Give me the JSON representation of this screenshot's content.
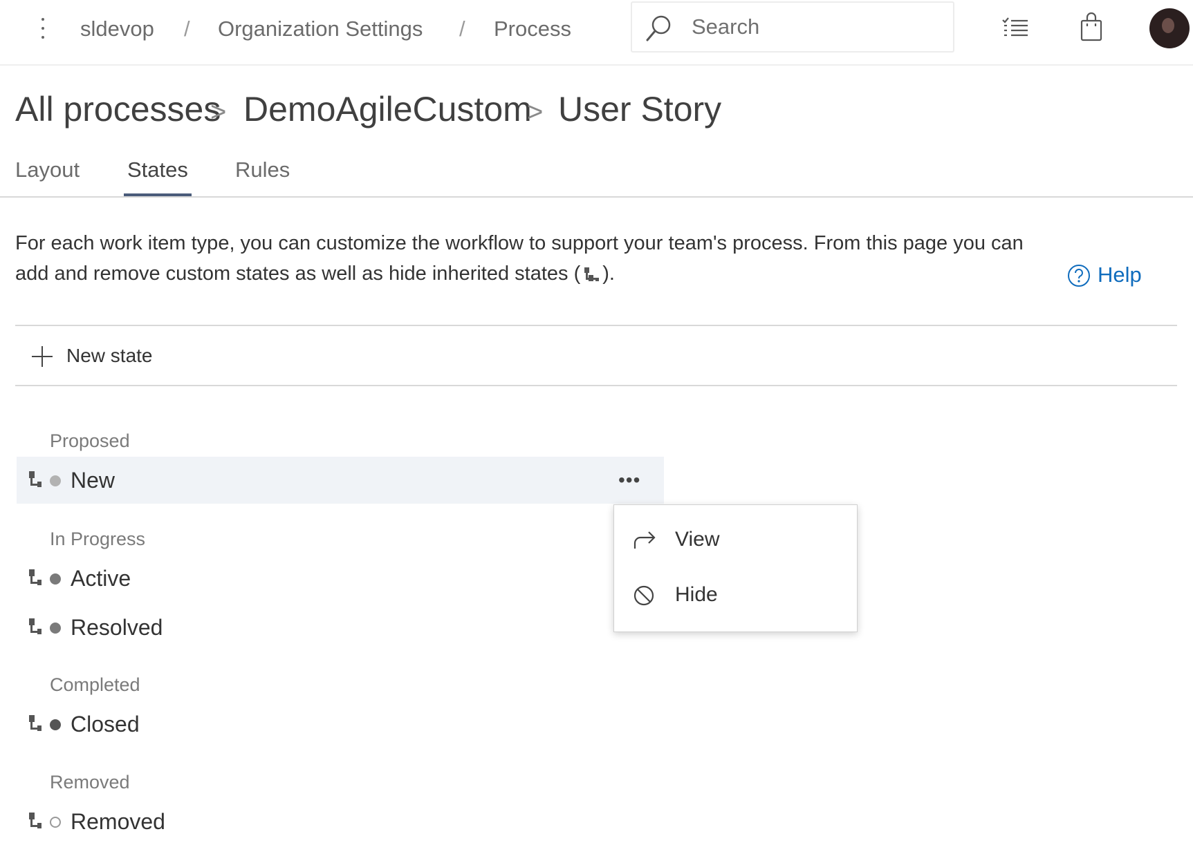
{
  "topbar": {
    "breadcrumb": [
      "sldevop",
      "Organization Settings",
      "Process"
    ],
    "separator": "/",
    "search_placeholder": "Search",
    "icons": [
      "more-vertical-icon",
      "search-icon",
      "checklist-icon",
      "shopping-bag-icon",
      "user-avatar"
    ]
  },
  "title": {
    "parts": [
      "All processes",
      "DemoAgileCustom",
      "User Story"
    ],
    "separator": ">"
  },
  "tabs": [
    {
      "label": "Layout",
      "active": false
    },
    {
      "label": "States",
      "active": true
    },
    {
      "label": "Rules",
      "active": false
    }
  ],
  "description": {
    "text_before": "For each work item type, you can customize the workflow to support your team's process. From this page you can add and remove custom states as well as hide inherited states (",
    "text_after": ")."
  },
  "help": {
    "label": "Help"
  },
  "toolbar": {
    "new_state_label": "New state"
  },
  "state_categories": [
    {
      "label": "Proposed",
      "states": [
        {
          "name": "New",
          "color": "#b2b2b2",
          "filled": true,
          "highlighted": true,
          "more": "•••"
        }
      ]
    },
    {
      "label": "In Progress",
      "states": [
        {
          "name": "Active",
          "color": "#7a7a7a",
          "filled": true
        },
        {
          "name": "Resolved",
          "color": "#7a7a7a",
          "filled": true
        }
      ]
    },
    {
      "label": "Completed",
      "states": [
        {
          "name": "Closed",
          "color": "#555555",
          "filled": true
        }
      ]
    },
    {
      "label": "Removed",
      "states": [
        {
          "name": "Removed",
          "color": "#999999",
          "filled": false
        }
      ]
    }
  ],
  "context_menu": {
    "items": [
      {
        "label": "View",
        "icon": "redo-arrow-icon"
      },
      {
        "label": "Hide",
        "icon": "block-icon"
      }
    ]
  },
  "colors": {
    "accent": "#0f6cbd",
    "tab_underline": "#4a5b7a",
    "row_highlight": "#f0f3f7"
  }
}
